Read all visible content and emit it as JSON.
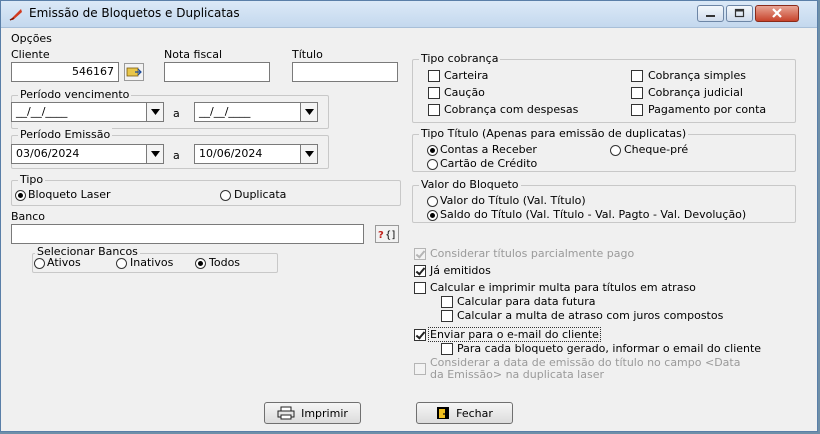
{
  "window": {
    "title": "Emissão de Bloquetos e Duplicatas"
  },
  "opcoes": "Opções",
  "fields": {
    "cliente_label": "Cliente",
    "cliente_value": "546167",
    "nota_label": "Nota fiscal",
    "nota_value": "",
    "titulo_label": "Título",
    "titulo_value": ""
  },
  "periodo_venc": {
    "label": "Período vencimento",
    "from": "__/__/____",
    "to": "__/__/____",
    "sep": "a"
  },
  "periodo_emis": {
    "label": "Período Emissão",
    "from": "03/06/2024",
    "to": "10/06/2024",
    "sep": "a"
  },
  "tipo": {
    "label": "Tipo",
    "options": [
      "Bloqueto Laser",
      "Duplicata"
    ],
    "selected": 0
  },
  "banco": {
    "label": "Banco",
    "value": ""
  },
  "sel_bancos": {
    "label": "Selecionar Bancos",
    "options": [
      "Ativos",
      "Inativos",
      "Todos"
    ],
    "selected": 2
  },
  "tipo_cobranca": {
    "label": "Tipo cobrança",
    "items": [
      "Carteira",
      "Cobrança simples",
      "Caução",
      "Cobrança judicial",
      "Cobrança com despesas",
      "Pagamento por conta"
    ]
  },
  "tipo_titulo": {
    "label": "Tipo Título (Apenas para emissão de duplicatas)",
    "options": [
      "Contas a Receber",
      "Cheque-pré",
      "Cartão de Crédito"
    ],
    "selected": 0
  },
  "valor_bloqueto": {
    "label": "Valor do Bloqueto",
    "options": [
      "Valor do Título   (Val. Título)",
      "Saldo do Título  (Val. Título - Val. Pagto - Val. Devolução)"
    ],
    "selected": 1
  },
  "options": {
    "parcial": "Considerar títulos parcialmente pago",
    "ja_emitidos": "Já emitidos",
    "multa": "Calcular e imprimir multa para títulos em atraso",
    "data_futura": "Calcular para data futura",
    "juros": "Calcular a multa de atraso com juros compostos",
    "email": "Enviar para o e-mail do cliente",
    "email_cliente": "Para cada bloqueto gerado, informar o email do cliente",
    "data_emissao": "Considerar a data de emissão do título no campo  <Data",
    "data_emissao2": "da Emissão> na duplicata laser"
  },
  "buttons": {
    "imprimir": "Imprimir",
    "fechar": "Fechar"
  },
  "colors": {
    "title_grad": "#c4d8ee",
    "close": "#c7432b"
  }
}
